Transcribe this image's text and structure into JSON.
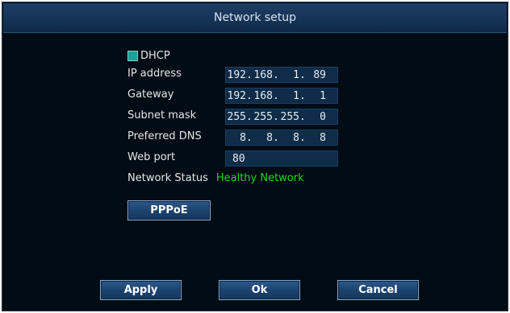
{
  "window": {
    "title": "Network setup"
  },
  "dhcp": {
    "label": "DHCP",
    "checked": true,
    "color": "#1aa19a"
  },
  "fields": {
    "ip_address": {
      "label": "IP address",
      "octets": [
        "192",
        "168",
        "1",
        "89"
      ]
    },
    "gateway": {
      "label": "Gateway",
      "octets": [
        "192",
        "168",
        "1",
        "1"
      ]
    },
    "subnet_mask": {
      "label": "Subnet mask",
      "octets": [
        "255",
        "255",
        "255",
        "0"
      ]
    },
    "preferred_dns": {
      "label": "Preferred DNS",
      "octets": [
        "8",
        "8",
        "8",
        "8"
      ]
    },
    "web_port": {
      "label": "Web port",
      "value": "80"
    }
  },
  "network_status": {
    "label": "Network Status",
    "value": "Healthy Network",
    "color": "#1fd41f"
  },
  "buttons": {
    "pppoe": "PPPoE",
    "apply": "Apply",
    "ok": "Ok",
    "cancel": "Cancel"
  }
}
